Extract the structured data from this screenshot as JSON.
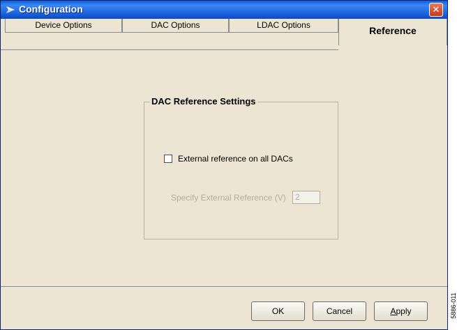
{
  "window": {
    "title": "Configuration",
    "close_label": "✕"
  },
  "tabs": [
    {
      "label": "Device Options",
      "active": false
    },
    {
      "label": "DAC Options",
      "active": false
    },
    {
      "label": "LDAC Options",
      "active": false
    },
    {
      "label": "Reference",
      "active": true
    }
  ],
  "reference_panel": {
    "group_title": "DAC Reference Settings",
    "external_ref_checkbox_label": "External reference on all DACs",
    "external_ref_checked": false,
    "specify_label": "Specify External Reference (V)",
    "specify_value": "2",
    "specify_enabled": false
  },
  "footer": {
    "ok_label": "OK",
    "cancel_label": "Cancel",
    "apply_label": "Apply"
  },
  "figure_id": "5886-011",
  "colors": {
    "title_bar": "#1b64dc",
    "dialog_face": "#ece5d4",
    "close_button": "#d9552f",
    "disabled_text": "#b4ad9f"
  }
}
